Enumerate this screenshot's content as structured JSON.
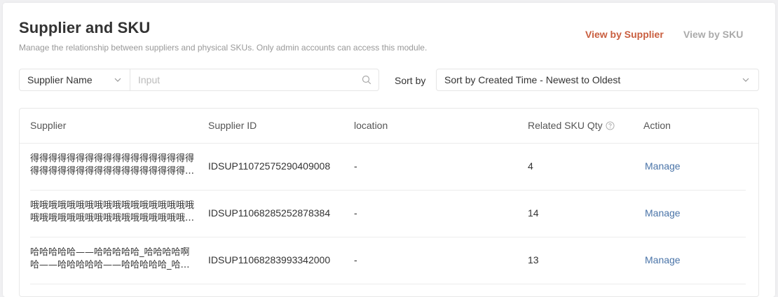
{
  "header": {
    "title": "Supplier and SKU",
    "subtitle": "Manage the relationship between suppliers and physical SKUs. Only admin accounts can access this module.",
    "view_by_supplier": "View by Supplier",
    "view_by_sku": "View by SKU"
  },
  "filters": {
    "field_select": "Supplier Name",
    "search_placeholder": "Input",
    "sort_label": "Sort by",
    "sort_value": "Sort by Created Time - Newest to Oldest"
  },
  "table": {
    "columns": {
      "supplier": "Supplier",
      "supplier_id": "Supplier ID",
      "location": "location",
      "related_qty": "Related SKU Qty",
      "action": "Action"
    },
    "rows": [
      {
        "supplier": "得得得得得得得得得得得得得得得得得得得得得得得得得得得得得得得得得得得得得得得得得",
        "supplier_id": "IDSUP11072575290409008",
        "location": "-",
        "qty": "4",
        "action": "Manage"
      },
      {
        "supplier": "哦哦哦哦哦哦哦哦哦哦哦哦哦哦哦哦哦哦哦哦哦哦哦哦哦哦哦哦哦哦哦哦哦哦哦哦哦哦哦哦",
        "supplier_id": "IDSUP11068285252878384",
        "location": "-",
        "qty": "14",
        "action": "Manage"
      },
      {
        "supplier": "哈哈哈哈哈——哈哈哈哈哈_哈哈哈哈啊哈——哈哈哈哈哈——哈哈哈哈哈_哈哈哈哈",
        "supplier_id": "IDSUP11068283993342000",
        "location": "-",
        "qty": "13",
        "action": "Manage"
      }
    ]
  },
  "colors": {
    "accent": "#c95e3f",
    "link": "#4a74a8",
    "muted": "#999999"
  },
  "icons": [
    "chevron-down-icon",
    "search-icon",
    "help-circle-icon"
  ]
}
